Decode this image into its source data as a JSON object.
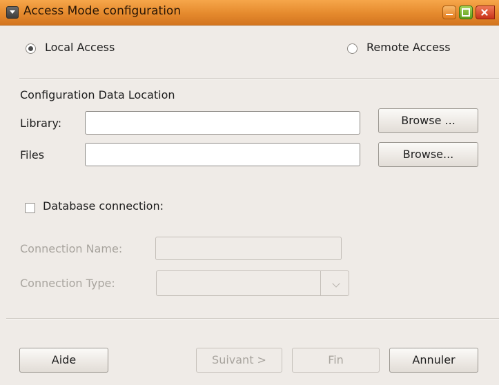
{
  "window": {
    "title": "Access Mode configuration"
  },
  "access_mode": {
    "local_label": "Local Access",
    "remote_label": "Remote Access",
    "selected": "local"
  },
  "config": {
    "section_title": "Configuration Data Location",
    "library_label": "Library:",
    "library_value": "",
    "files_label": "Files",
    "files_value": "",
    "browse_library_label": "Browse ...",
    "browse_files_label": "Browse..."
  },
  "database": {
    "checkbox_label": "Database connection:",
    "checked": false,
    "connection_name_label": "Connection Name:",
    "connection_name_value": "",
    "connection_type_label": "Connection Type:",
    "connection_type_value": ""
  },
  "footer": {
    "help_label": "Aide",
    "next_label": "Suivant >",
    "finish_label": "Fin",
    "cancel_label": "Annuler"
  }
}
